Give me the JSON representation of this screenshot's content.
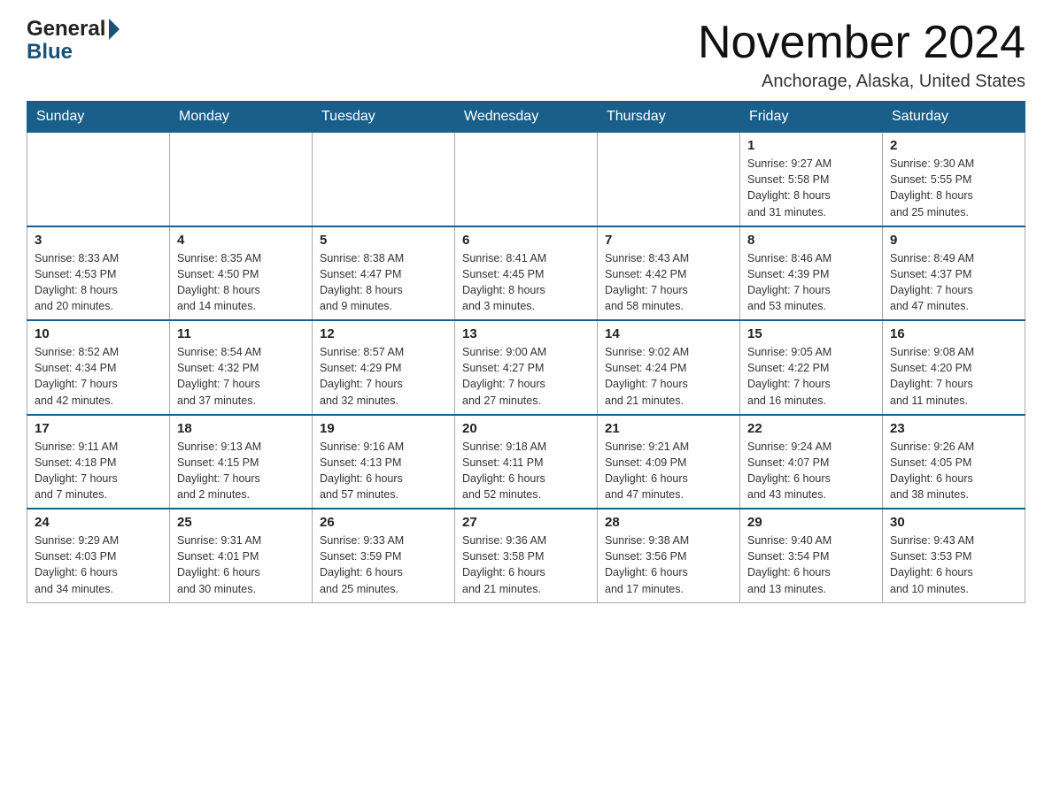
{
  "header": {
    "logo_general": "General",
    "logo_blue": "Blue",
    "title": "November 2024",
    "location": "Anchorage, Alaska, United States"
  },
  "weekdays": [
    "Sunday",
    "Monday",
    "Tuesday",
    "Wednesday",
    "Thursday",
    "Friday",
    "Saturday"
  ],
  "weeks": [
    [
      {
        "day": "",
        "info": ""
      },
      {
        "day": "",
        "info": ""
      },
      {
        "day": "",
        "info": ""
      },
      {
        "day": "",
        "info": ""
      },
      {
        "day": "",
        "info": ""
      },
      {
        "day": "1",
        "info": "Sunrise: 9:27 AM\nSunset: 5:58 PM\nDaylight: 8 hours\nand 31 minutes."
      },
      {
        "day": "2",
        "info": "Sunrise: 9:30 AM\nSunset: 5:55 PM\nDaylight: 8 hours\nand 25 minutes."
      }
    ],
    [
      {
        "day": "3",
        "info": "Sunrise: 8:33 AM\nSunset: 4:53 PM\nDaylight: 8 hours\nand 20 minutes."
      },
      {
        "day": "4",
        "info": "Sunrise: 8:35 AM\nSunset: 4:50 PM\nDaylight: 8 hours\nand 14 minutes."
      },
      {
        "day": "5",
        "info": "Sunrise: 8:38 AM\nSunset: 4:47 PM\nDaylight: 8 hours\nand 9 minutes."
      },
      {
        "day": "6",
        "info": "Sunrise: 8:41 AM\nSunset: 4:45 PM\nDaylight: 8 hours\nand 3 minutes."
      },
      {
        "day": "7",
        "info": "Sunrise: 8:43 AM\nSunset: 4:42 PM\nDaylight: 7 hours\nand 58 minutes."
      },
      {
        "day": "8",
        "info": "Sunrise: 8:46 AM\nSunset: 4:39 PM\nDaylight: 7 hours\nand 53 minutes."
      },
      {
        "day": "9",
        "info": "Sunrise: 8:49 AM\nSunset: 4:37 PM\nDaylight: 7 hours\nand 47 minutes."
      }
    ],
    [
      {
        "day": "10",
        "info": "Sunrise: 8:52 AM\nSunset: 4:34 PM\nDaylight: 7 hours\nand 42 minutes."
      },
      {
        "day": "11",
        "info": "Sunrise: 8:54 AM\nSunset: 4:32 PM\nDaylight: 7 hours\nand 37 minutes."
      },
      {
        "day": "12",
        "info": "Sunrise: 8:57 AM\nSunset: 4:29 PM\nDaylight: 7 hours\nand 32 minutes."
      },
      {
        "day": "13",
        "info": "Sunrise: 9:00 AM\nSunset: 4:27 PM\nDaylight: 7 hours\nand 27 minutes."
      },
      {
        "day": "14",
        "info": "Sunrise: 9:02 AM\nSunset: 4:24 PM\nDaylight: 7 hours\nand 21 minutes."
      },
      {
        "day": "15",
        "info": "Sunrise: 9:05 AM\nSunset: 4:22 PM\nDaylight: 7 hours\nand 16 minutes."
      },
      {
        "day": "16",
        "info": "Sunrise: 9:08 AM\nSunset: 4:20 PM\nDaylight: 7 hours\nand 11 minutes."
      }
    ],
    [
      {
        "day": "17",
        "info": "Sunrise: 9:11 AM\nSunset: 4:18 PM\nDaylight: 7 hours\nand 7 minutes."
      },
      {
        "day": "18",
        "info": "Sunrise: 9:13 AM\nSunset: 4:15 PM\nDaylight: 7 hours\nand 2 minutes."
      },
      {
        "day": "19",
        "info": "Sunrise: 9:16 AM\nSunset: 4:13 PM\nDaylight: 6 hours\nand 57 minutes."
      },
      {
        "day": "20",
        "info": "Sunrise: 9:18 AM\nSunset: 4:11 PM\nDaylight: 6 hours\nand 52 minutes."
      },
      {
        "day": "21",
        "info": "Sunrise: 9:21 AM\nSunset: 4:09 PM\nDaylight: 6 hours\nand 47 minutes."
      },
      {
        "day": "22",
        "info": "Sunrise: 9:24 AM\nSunset: 4:07 PM\nDaylight: 6 hours\nand 43 minutes."
      },
      {
        "day": "23",
        "info": "Sunrise: 9:26 AM\nSunset: 4:05 PM\nDaylight: 6 hours\nand 38 minutes."
      }
    ],
    [
      {
        "day": "24",
        "info": "Sunrise: 9:29 AM\nSunset: 4:03 PM\nDaylight: 6 hours\nand 34 minutes."
      },
      {
        "day": "25",
        "info": "Sunrise: 9:31 AM\nSunset: 4:01 PM\nDaylight: 6 hours\nand 30 minutes."
      },
      {
        "day": "26",
        "info": "Sunrise: 9:33 AM\nSunset: 3:59 PM\nDaylight: 6 hours\nand 25 minutes."
      },
      {
        "day": "27",
        "info": "Sunrise: 9:36 AM\nSunset: 3:58 PM\nDaylight: 6 hours\nand 21 minutes."
      },
      {
        "day": "28",
        "info": "Sunrise: 9:38 AM\nSunset: 3:56 PM\nDaylight: 6 hours\nand 17 minutes."
      },
      {
        "day": "29",
        "info": "Sunrise: 9:40 AM\nSunset: 3:54 PM\nDaylight: 6 hours\nand 13 minutes."
      },
      {
        "day": "30",
        "info": "Sunrise: 9:43 AM\nSunset: 3:53 PM\nDaylight: 6 hours\nand 10 minutes."
      }
    ]
  ]
}
